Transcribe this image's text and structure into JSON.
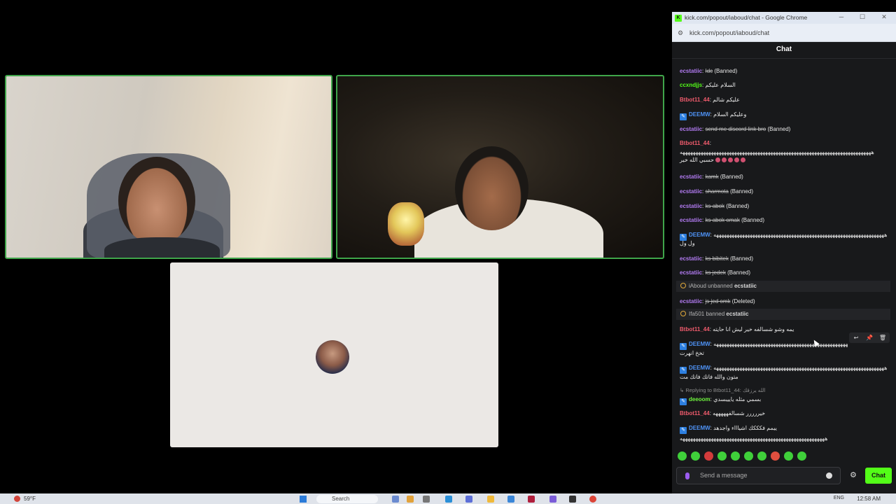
{
  "taskbar": {
    "weather": "59°F",
    "search_placeholder": "Search",
    "language": "ENG",
    "clock": "12:58 AM"
  },
  "chrome": {
    "window_title": "kick.com/popout/iaboud/chat - Google Chrome",
    "url": "kick.com/popout/iaboud/chat"
  },
  "chat": {
    "header": "Chat",
    "input_placeholder": "Send a message",
    "send_label": "Chat",
    "messages": [
      {
        "user": "ecstatiic",
        "text": "Idc",
        "tag": "(Banned)"
      },
      {
        "user": "ccxndjjs",
        "text": "السلام عليكم",
        "tag": ""
      },
      {
        "user": "Btbot11_44",
        "text": "عليكم شالم",
        "tag": ""
      },
      {
        "user": "DEEMW",
        "text": "وعليكم السلام",
        "tag": ""
      },
      {
        "user": "ecstatiic",
        "text": "send me discord link bro",
        "tag": "(Banned)"
      },
      {
        "user": "Btbot11_44",
        "text": "",
        "tag": ""
      },
      {
        "user": "",
        "text": "ههههههههههههههههههههههههههههههههههههههههههههههههههههههههههههههههههههههههههه",
        "tag": ""
      },
      {
        "user": "",
        "text": "حسبي الله خير",
        "tag": ""
      },
      {
        "user": "ecstatiic",
        "text": "kamk",
        "tag": "(Banned)"
      },
      {
        "user": "ecstatiic",
        "text": "sharmota",
        "tag": "(Banned)"
      },
      {
        "user": "ecstatiic",
        "text": "ks abok",
        "tag": "(Banned)"
      },
      {
        "user": "ecstatiic",
        "text": "ks abok omak",
        "tag": "(Banned)"
      },
      {
        "user": "DEEMW",
        "text": "ههههههههههههههههههههههههههههههههههههههههههههههههههههههههههههههههههه",
        "tag": ""
      },
      {
        "user": "",
        "text": "ول ول",
        "tag": ""
      },
      {
        "user": "ecstatiic",
        "text": "ks bibitek",
        "tag": "(Banned)"
      },
      {
        "user": "ecstatiic",
        "text": "ks jedek",
        "tag": "(Banned)"
      },
      {
        "user": "iAboud",
        "text": "unbanned",
        "tag": "ecstatiic"
      },
      {
        "user": "ecstatiic",
        "text": "js jed omk",
        "tag": "(Deleted)"
      },
      {
        "user": "Ifa501",
        "text": "banned",
        "tag": "ecstatiic"
      },
      {
        "user": "Btbot11_44",
        "text": "يمه وشو شسالفه خير ليش انا حايته",
        "tag": ""
      },
      {
        "user": "DEEMW",
        "text": "هههههههههههههههههههههههههههههههههههههههههههههههههههههههههههههه",
        "tag": ""
      },
      {
        "user": "",
        "text": "تخخ انهرت",
        "tag": ""
      },
      {
        "user": "DEEMW",
        "text": "ههههههههههههههههههههههههههههههههههههههههههههههههههههههههههههههههههه",
        "tag": ""
      },
      {
        "user": "",
        "text": "متون والله فاتك فاتك مت",
        "tag": ""
      },
      {
        "user": "",
        "text": "Replying to Btbot11_44: الله يرزقك",
        "tag": ""
      },
      {
        "user": "deeoom",
        "text": "بسمي مثله ياييبسدي",
        "tag": ""
      },
      {
        "user": "Btbot11_44",
        "text": "خيررررر شسالفهههههه",
        "tag": ""
      },
      {
        "user": "DEEMW",
        "text": "ييمم فكككك اشياااء واجدهد",
        "tag": ""
      },
      {
        "user": "",
        "text": "ههههههههههههههههههههههههههههههههههههههههههههههههههههههههه",
        "tag": ""
      }
    ]
  },
  "colors": {
    "kick_green": "#53fc18",
    "tile_border": "#3fa54a",
    "user_purple": "#b27bf2",
    "user_red": "#ef5b6c",
    "user_blue": "#4e92f5"
  }
}
